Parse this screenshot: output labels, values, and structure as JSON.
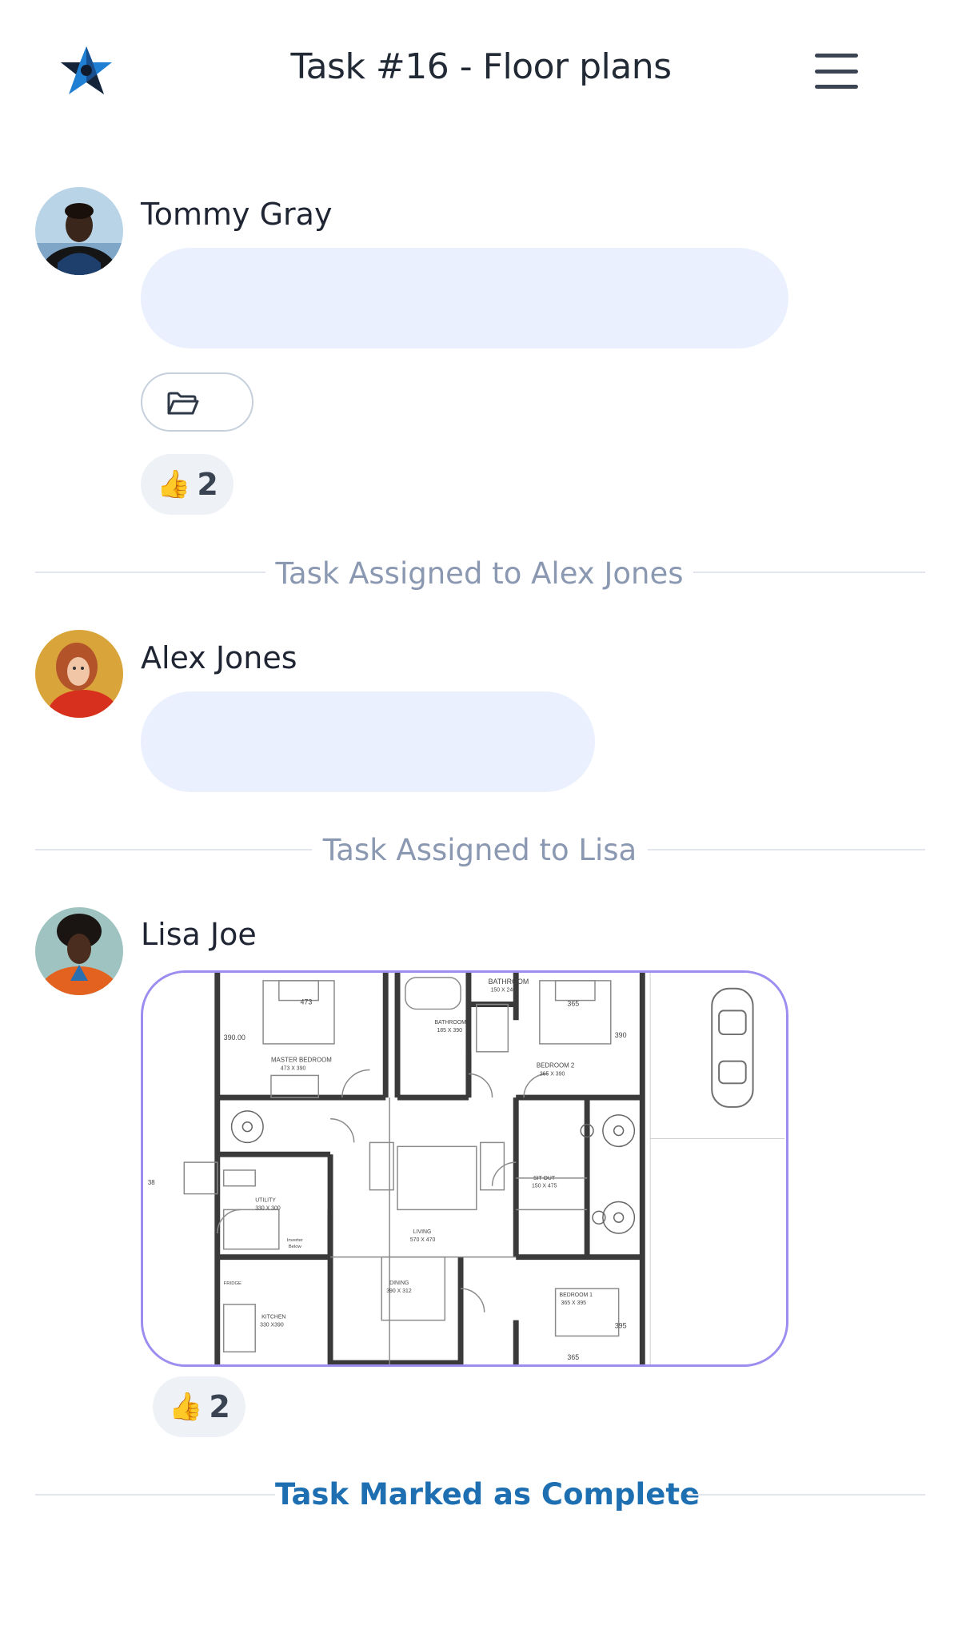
{
  "header": {
    "title": "Task #16 - Floor plans",
    "logo_icon": "star-logo-icon",
    "menu_icon": "hamburger-menu-icon"
  },
  "messages": [
    {
      "author": "Tommy Gray",
      "avatar": "avatar-tommy-gray",
      "attachment_icon": "folder-icon",
      "reaction": {
        "emoji": "👍",
        "count": "2"
      }
    },
    {
      "author": "Alex Jones",
      "avatar": "avatar-alex-jones"
    },
    {
      "author": "Lisa Joe",
      "avatar": "avatar-lisa-joe",
      "image": "floor-plan",
      "reaction": {
        "emoji": "👍",
        "count": "2"
      }
    }
  ],
  "events": {
    "assigned_alex": "Task Assigned to Alex Jones",
    "assigned_lisa": "Task Assigned to Lisa",
    "completed": "Task Marked as Complete"
  },
  "floor_plan": {
    "labels": {
      "bathroom_top": "BATHROOM",
      "bathroom_top_size": "150 X 240",
      "master_dim": "473",
      "master_side_dim": "390.00",
      "master": "MASTER BEDROOM",
      "master_size": "473 X 390",
      "bathroom": "BATHROOM",
      "bathroom_size": "185 X 390",
      "bed2_dim": "365",
      "bed2_side_dim": "390",
      "bed2": "BEDROOM 2",
      "bed2_size": "365 X 390",
      "utility": "UTILITY",
      "utility_size": "330 X 300",
      "inverter": "Inverter",
      "inverter2": "Below",
      "living": "LIVING",
      "living_size": "570 X 470",
      "sitout": "SIT OUT",
      "sitout_size": "150 X 475",
      "dining": "DINING",
      "dining_size": "390 X 312",
      "kitchen": "KITCHEN",
      "kitchen_size": "330 X390",
      "fridge": "FRIDGE",
      "bed1": "BEDROOM 1",
      "bed1_size": "365 X 395",
      "bed1_dim": "365",
      "bed1_side_dim": "395",
      "left_dim": "38"
    }
  },
  "colors": {
    "bubble": "#eaf0fd",
    "accent_complete": "#1d6fb2",
    "divider_text": "#8a98b2",
    "image_border": "#9b8ef0"
  }
}
